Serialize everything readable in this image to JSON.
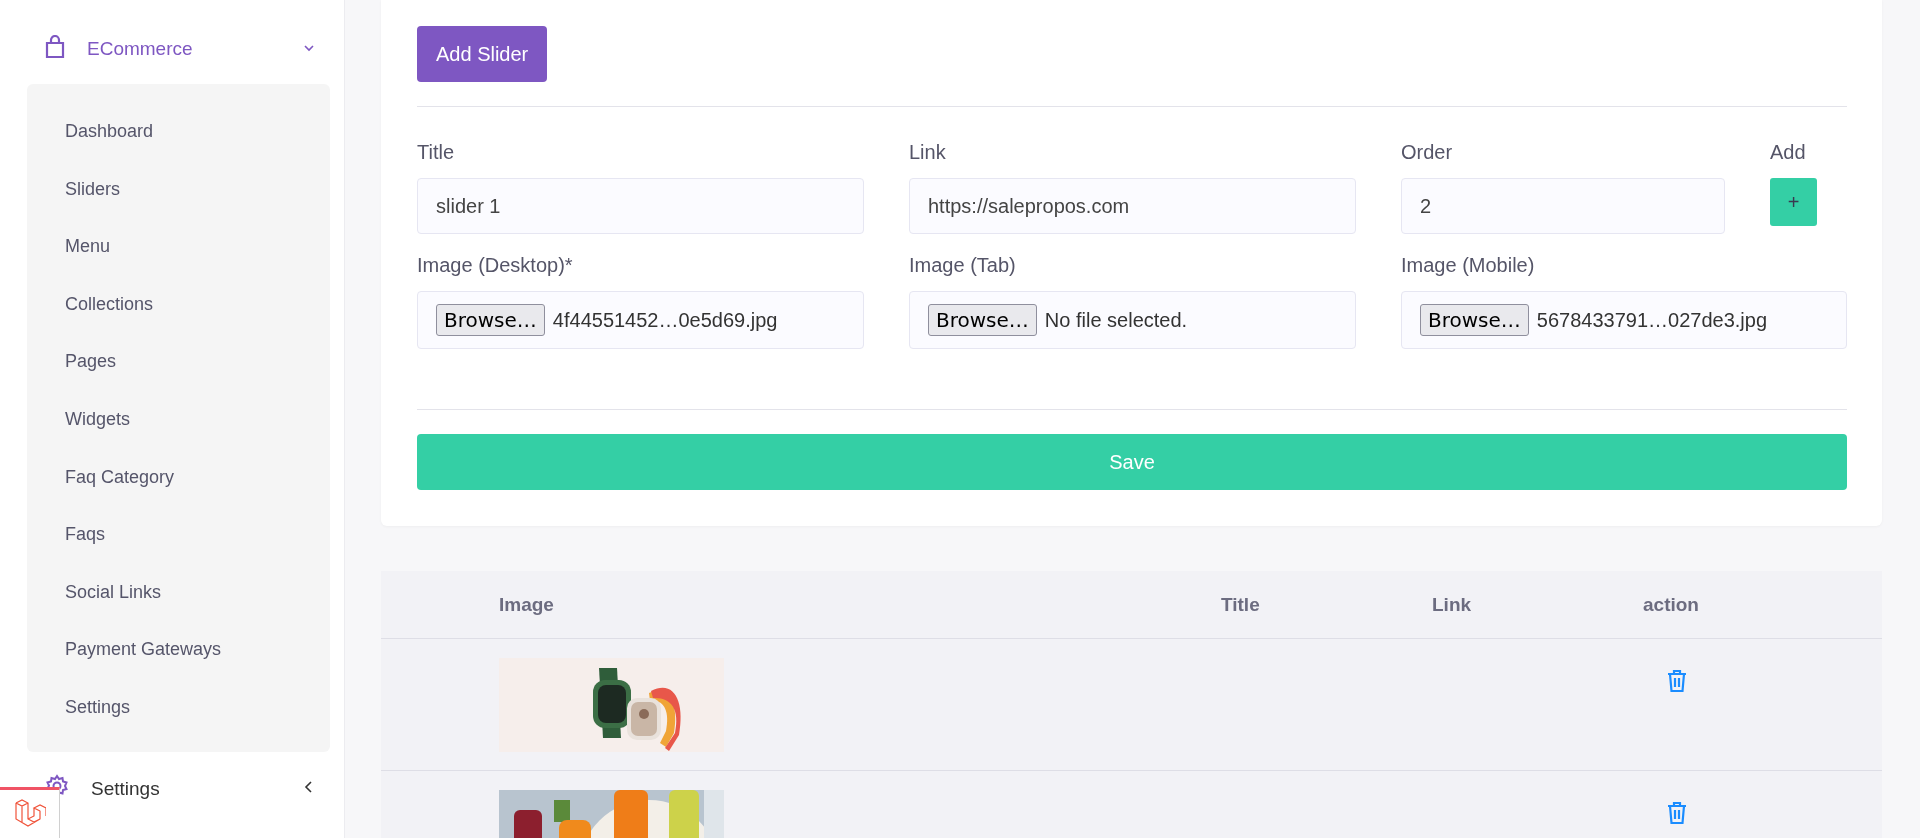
{
  "sidebar": {
    "groups": [
      {
        "kind": "bag",
        "label": "ECommerce",
        "expanded": true,
        "items": [
          {
            "label": "Dashboard",
            "selected": false
          },
          {
            "label": "Sliders",
            "selected": false
          },
          {
            "label": "Menu",
            "selected": false
          },
          {
            "label": "Collections",
            "selected": false
          },
          {
            "label": "Pages",
            "selected": false
          },
          {
            "label": "Widgets",
            "selected": false
          },
          {
            "label": "Faq Category",
            "selected": false
          },
          {
            "label": "Faqs",
            "selected": false
          },
          {
            "label": "Social Links",
            "selected": false
          },
          {
            "label": "Payment Gateways",
            "selected": false
          },
          {
            "label": "Settings",
            "selected": false
          }
        ]
      },
      {
        "kind": "gear",
        "label": "Settings",
        "expanded": false
      }
    ]
  },
  "form": {
    "add_button": "Add Slider",
    "fields": [
      {
        "label": "Title",
        "value": "slider 1"
      },
      {
        "label": "Link",
        "value": "https://salepropos.com"
      },
      {
        "label": "Order",
        "value": "2"
      }
    ],
    "add": {
      "label": "Add",
      "button": "+"
    },
    "files": [
      {
        "label": "Image (Desktop)*",
        "button": "Browse…",
        "file": "4f44551452…0e5d69.jpg"
      },
      {
        "label": "Image (Tab)",
        "button": "Browse…",
        "file": "No file selected."
      },
      {
        "label": "Image (Mobile)",
        "button": "Browse…",
        "file": "5678433791…027de3.jpg"
      }
    ],
    "save": "Save"
  },
  "table": {
    "columns": [
      "Image",
      "Title",
      "Link",
      "action"
    ]
  }
}
